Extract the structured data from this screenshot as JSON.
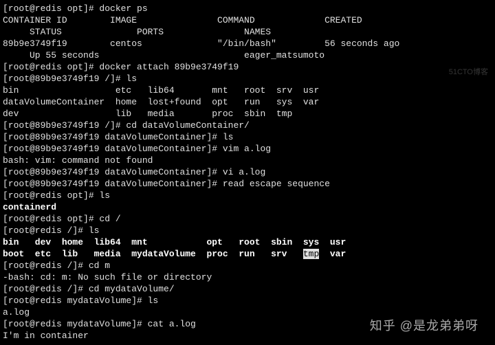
{
  "lines": [
    {
      "segments": [
        {
          "t": "[root@redis opt]# docker ps"
        }
      ]
    },
    {
      "segments": [
        {
          "t": "CONTAINER ID        IMAGE               COMMAND             CREATED"
        }
      ]
    },
    {
      "segments": [
        {
          "t": "     STATUS              PORTS               NAMES"
        }
      ]
    },
    {
      "segments": [
        {
          "t": "89b9e3749f19        centos              \"/bin/bash\"         56 seconds ago"
        }
      ]
    },
    {
      "segments": [
        {
          "t": "     Up 55 seconds                           eager_matsumoto"
        }
      ]
    },
    {
      "segments": [
        {
          "t": "[root@redis opt]# docker attach 89b9e3749f19"
        }
      ]
    },
    {
      "segments": [
        {
          "t": "[root@89b9e3749f19 /]# ls"
        }
      ]
    },
    {
      "segments": [
        {
          "t": "bin                  etc   lib64       mnt   root  srv  usr"
        }
      ]
    },
    {
      "segments": [
        {
          "t": "dataVolumeContainer  home  lost+found  opt   run   sys  var"
        }
      ]
    },
    {
      "segments": [
        {
          "t": "dev                  lib   media       proc  sbin  tmp"
        }
      ]
    },
    {
      "segments": [
        {
          "t": "[root@89b9e3749f19 /]# cd dataVolumeContainer/"
        }
      ]
    },
    {
      "segments": [
        {
          "t": "[root@89b9e3749f19 dataVolumeContainer]# ls"
        }
      ]
    },
    {
      "segments": [
        {
          "t": "[root@89b9e3749f19 dataVolumeContainer]# vim a.log"
        }
      ]
    },
    {
      "segments": [
        {
          "t": "bash: vim: command not found"
        }
      ]
    },
    {
      "segments": [
        {
          "t": "[root@89b9e3749f19 dataVolumeContainer]# vi a.log"
        }
      ]
    },
    {
      "segments": [
        {
          "t": "[root@89b9e3749f19 dataVolumeContainer]# read escape sequence"
        }
      ]
    },
    {
      "segments": [
        {
          "t": "[root@redis opt]# ls"
        }
      ]
    },
    {
      "segments": [
        {
          "t": "containerd",
          "cls": "bold"
        }
      ]
    },
    {
      "segments": [
        {
          "t": "[root@redis opt]# cd /"
        }
      ]
    },
    {
      "segments": [
        {
          "t": "[root@redis /]# ls"
        }
      ]
    },
    {
      "segments": [
        {
          "t": "bin   dev  home  lib64  mnt           opt   root  sbin  sys  usr",
          "cls": "bold"
        }
      ]
    },
    {
      "segments": [
        {
          "t": "boot  etc  lib   media  mydataVolume  proc  run   srv   ",
          "cls": "bold"
        },
        {
          "t": "tmp",
          "cls": "hl"
        },
        {
          "t": "  var",
          "cls": "bold"
        }
      ]
    },
    {
      "segments": [
        {
          "t": "[root@redis /]# cd m"
        }
      ]
    },
    {
      "segments": [
        {
          "t": "-bash: cd: m: No such file or directory"
        }
      ]
    },
    {
      "segments": [
        {
          "t": "[root@redis /]# cd mydataVolume/"
        }
      ]
    },
    {
      "segments": [
        {
          "t": "[root@redis mydataVolume]# ls"
        }
      ]
    },
    {
      "segments": [
        {
          "t": "a.log"
        }
      ]
    },
    {
      "segments": [
        {
          "t": "[root@redis mydataVolume]# cat a.log"
        }
      ]
    },
    {
      "segments": [
        {
          "t": "I'm in container"
        }
      ]
    }
  ],
  "watermark_main": "知乎 @是龙弟弟呀",
  "watermark_small": "51CTO博客"
}
